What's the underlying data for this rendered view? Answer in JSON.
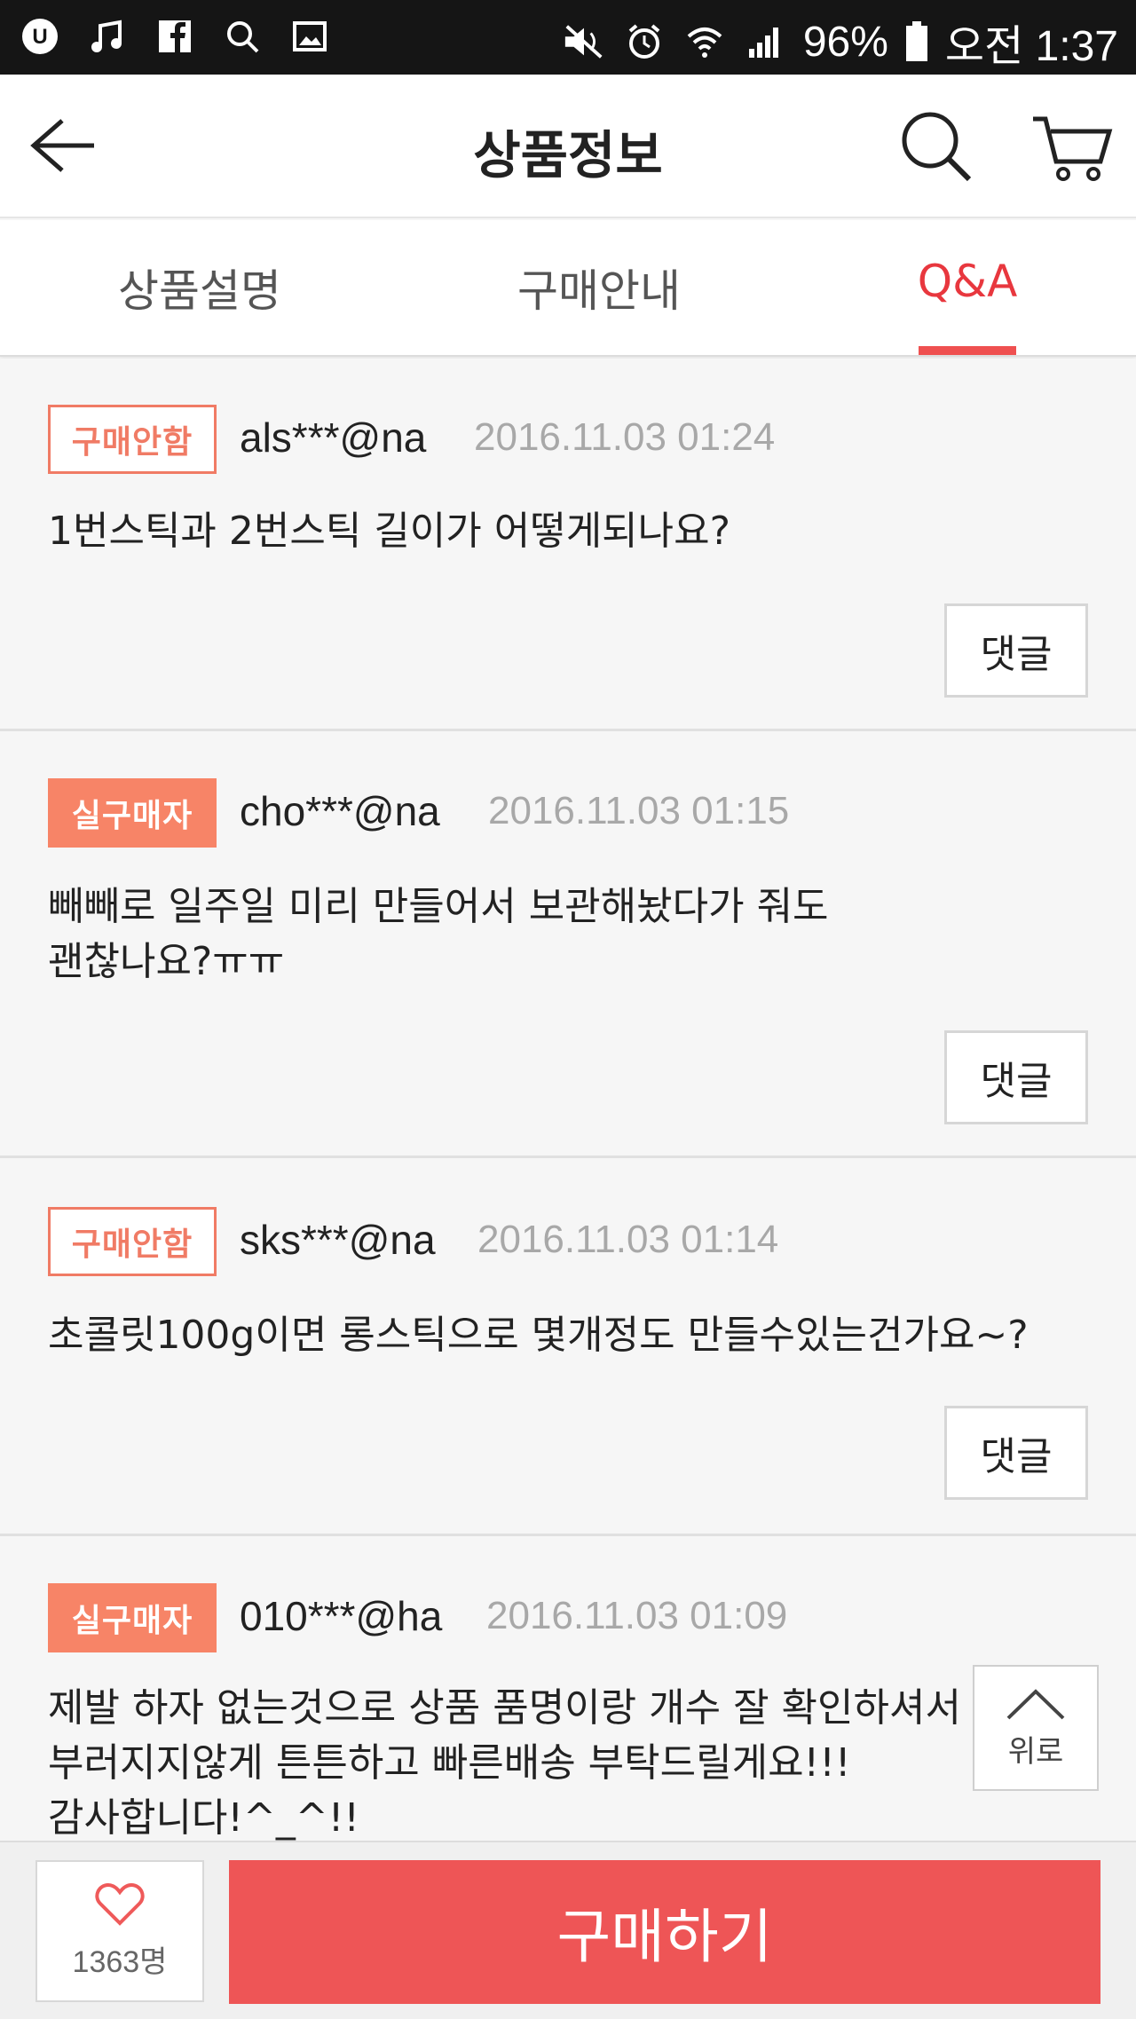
{
  "status_bar": {
    "icons_left": [
      "u-plus-icon",
      "music-icon",
      "facebook-icon",
      "search-icon",
      "image-icon"
    ],
    "icons_right": [
      "mute-icon",
      "alarm-icon",
      "wifi-icon",
      "signal-icon"
    ],
    "battery": "96%",
    "battery_icon": "battery-icon",
    "time": "오전 1:37"
  },
  "header": {
    "title": "상품정보",
    "back_icon": "back-arrow-icon",
    "search_icon": "search-icon",
    "cart_icon": "cart-icon"
  },
  "tabs": [
    {
      "label": "상품설명",
      "active": false
    },
    {
      "label": "구매안내",
      "active": false
    },
    {
      "label": "Q&A",
      "active": true
    }
  ],
  "qa_list": [
    {
      "badge": "구매안함",
      "badge_style": "outline",
      "user": "als***@na",
      "date": "2016.11.03 01:24",
      "lines": [
        "1번스틱과 2번스틱 길이가 어떻게되나요?"
      ],
      "reply_label": "댓글"
    },
    {
      "badge": "실구매자",
      "badge_style": "filled",
      "user": "cho***@na",
      "date": "2016.11.03 01:15",
      "lines": [
        "빼빼로 일주일 미리 만들어서 보관해놨다가 줘도",
        "괜찮나요?ㅠㅠ"
      ],
      "reply_label": "댓글"
    },
    {
      "badge": "구매안함",
      "badge_style": "outline",
      "user": "sks***@na",
      "date": "2016.11.03 01:14",
      "lines": [
        "초콜릿100g이면 롱스틱으로 몇개정도 만들수있는건가요~?"
      ],
      "reply_label": "댓글"
    },
    {
      "badge": "실구매자",
      "badge_style": "filled",
      "user": "010***@ha",
      "date": "2016.11.03 01:09",
      "lines": [
        "제발 하자 없는것으로 상품 품명이랑 개수 잘 확인하셔서",
        "부러지지않게 튼튼하고 빠른배송 부탁드릴게요!!!",
        "감사합니다!^_^!!"
      ]
    }
  ],
  "top_button": {
    "label": "위로",
    "icon": "chevron-up-icon"
  },
  "bottom_bar": {
    "like_icon": "heart-icon",
    "like_count": "1363명",
    "buy_label": "구매하기"
  },
  "colors": {
    "accent": "#e8373e",
    "buy_button": "#ee5556",
    "badge_filled": "#f78467",
    "badge_outline": "#f07b65"
  }
}
